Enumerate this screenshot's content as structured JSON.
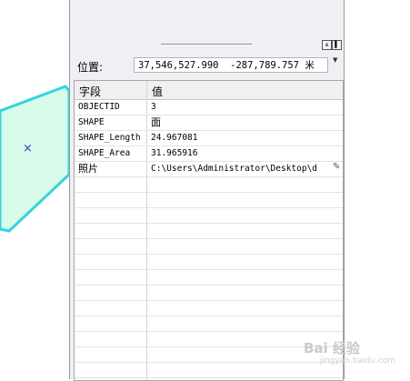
{
  "map": {
    "polygon_fill": "#d9fbea",
    "polygon_stroke": "#2fd6e0",
    "marker": "×"
  },
  "window": {
    "btn_restore": "⩓",
    "btn_close": "▌"
  },
  "location": {
    "label": "位置:",
    "value": "37,546,527.990  -287,789.757 米"
  },
  "table": {
    "headers": {
      "field": "字段",
      "value": "值"
    },
    "rows": [
      {
        "field": "OBJECTID",
        "value": "3"
      },
      {
        "field": "SHAPE",
        "value": "面"
      },
      {
        "field": "SHAPE_Length",
        "value": "24.967081"
      },
      {
        "field": "SHAPE_Area",
        "value": "31.965916"
      },
      {
        "field": "照片",
        "value": "C:\\Users\\Administrator\\Desktop\\d"
      }
    ]
  },
  "watermark": {
    "text": "Bai 经验",
    "sub": "jingyan.baidu.com"
  },
  "colors": {
    "panel_bg": "#eef0f3",
    "table_bg": "#ffffff",
    "header_bg": "#f0f0f0",
    "grid": "#e4e4e4"
  }
}
